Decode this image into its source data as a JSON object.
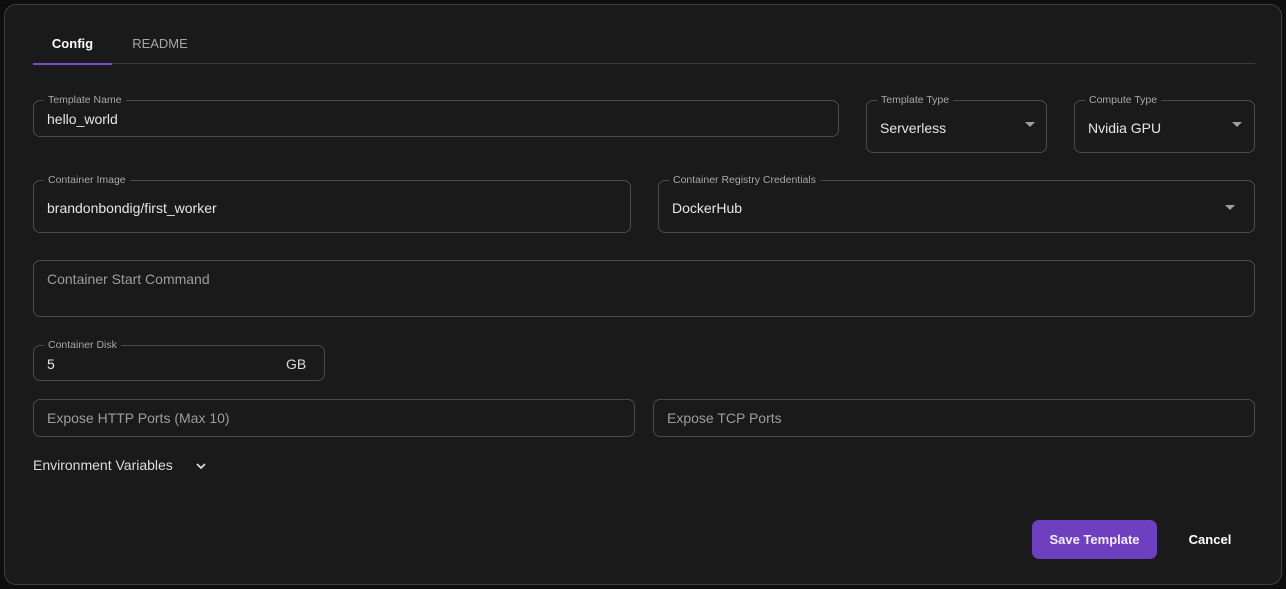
{
  "tabs": [
    {
      "label": "Config",
      "active": true
    },
    {
      "label": "README",
      "active": false
    }
  ],
  "form": {
    "template_name": {
      "label": "Template Name",
      "value": "hello_world"
    },
    "template_type": {
      "label": "Template Type",
      "value": "Serverless"
    },
    "compute_type": {
      "label": "Compute Type",
      "value": "Nvidia GPU"
    },
    "container_image": {
      "label": "Container Image",
      "value": "brandonbondig/first_worker"
    },
    "registry_credentials": {
      "label": "Container Registry Credentials",
      "value": "DockerHub"
    },
    "start_command": {
      "placeholder": "Container Start Command"
    },
    "container_disk": {
      "label": "Container Disk",
      "value": "5",
      "unit": "GB"
    },
    "http_ports": {
      "placeholder": "Expose HTTP Ports (Max 10)"
    },
    "tcp_ports": {
      "placeholder": "Expose TCP Ports"
    },
    "env_vars": {
      "label": "Environment Variables",
      "icon": "chevron-down-icon"
    }
  },
  "actions": {
    "save_label": "Save Template",
    "cancel_label": "Cancel"
  },
  "colors": {
    "accent": "#6e3fbf",
    "background": "#1a1a1a",
    "border": "#4a4a4a"
  }
}
